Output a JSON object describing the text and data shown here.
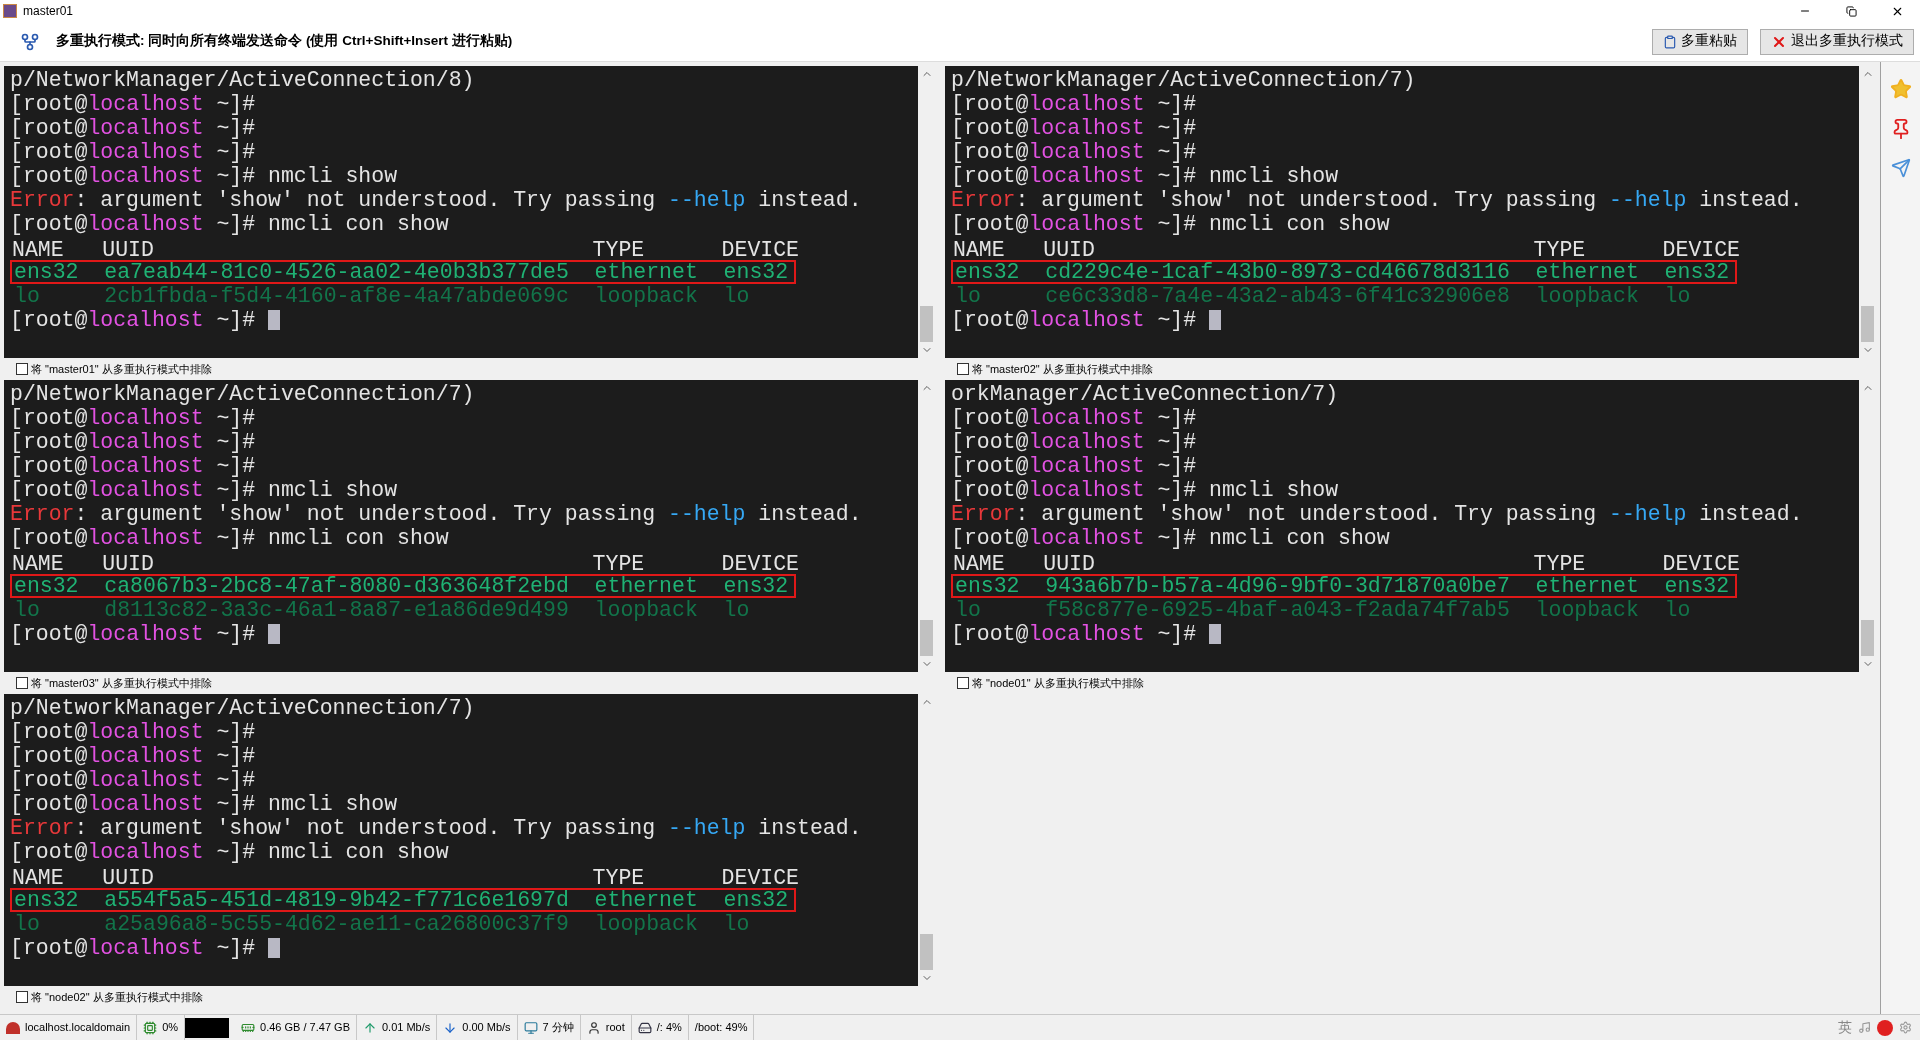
{
  "window": {
    "title": "master01"
  },
  "toolbar": {
    "message": "多重执行模式: 同时向所有终端发送命令 (使用 **Ctrl+Shift+Insert** 进行粘贴)",
    "buttons": [
      {
        "kind": "paste",
        "label": "多重粘贴"
      },
      {
        "kind": "exit",
        "label": "退出多重执行模式"
      }
    ]
  },
  "terminals": [
    {
      "exclude": {
        "label": "将 \"master01\" 从多重执行模式中排除",
        "checked": false
      },
      "lines": [
        {
          "kind": "text",
          "text": "p/NetworkManager/ActiveConnection/8)"
        },
        {
          "kind": "prompt",
          "user": "[root@",
          "host": "localhost",
          "suffix": " ~]#",
          "cursor": false
        },
        {
          "kind": "prompt",
          "user": "[root@",
          "host": "localhost",
          "suffix": " ~]#",
          "cursor": false
        },
        {
          "kind": "prompt",
          "user": "[root@",
          "host": "localhost",
          "suffix": " ~]#",
          "cursor": false
        },
        {
          "kind": "prompt",
          "user": "[root@",
          "host": "localhost",
          "suffix": " ~]#",
          "command": "nmcli show",
          "cursor": false
        },
        {
          "kind": "error",
          "label": "Error",
          "text": ": argument 'show' not understood. Try passing ",
          "flag": "--help",
          "rest": " instead."
        },
        {
          "kind": "prompt",
          "user": "[root@",
          "host": "localhost",
          "suffix": " ~]#",
          "command": "nmcli con show",
          "cursor": false
        },
        {
          "kind": "header",
          "cells": [
            "NAME",
            "UUID",
            "TYPE",
            "DEVICE"
          ]
        },
        {
          "kind": "row",
          "cells": [
            "ens32",
            "ea7eab44-81c0-4526-aa02-4e0b3b377de5",
            "ethernet",
            "ens32"
          ],
          "highlighted": true,
          "dim": false
        },
        {
          "kind": "row",
          "cells": [
            "lo",
            "2cb1fbda-f5d4-4160-af8e-4a47abde069c",
            "loopback",
            "lo"
          ],
          "highlighted": false,
          "dim": true
        },
        {
          "kind": "prompt",
          "user": "[root@",
          "host": "localhost",
          "suffix": " ~]#",
          "cursor": true
        }
      ]
    },
    {
      "exclude": {
        "label": "将 \"master02\" 从多重执行模式中排除",
        "checked": false
      },
      "lines": [
        {
          "kind": "text",
          "text": "p/NetworkManager/ActiveConnection/7)"
        },
        {
          "kind": "prompt",
          "user": "[root@",
          "host": "localhost",
          "suffix": " ~]#",
          "cursor": false
        },
        {
          "kind": "prompt",
          "user": "[root@",
          "host": "localhost",
          "suffix": " ~]#",
          "cursor": false
        },
        {
          "kind": "prompt",
          "user": "[root@",
          "host": "localhost",
          "suffix": " ~]#",
          "cursor": false
        },
        {
          "kind": "prompt",
          "user": "[root@",
          "host": "localhost",
          "suffix": " ~]#",
          "command": "nmcli show",
          "cursor": false
        },
        {
          "kind": "error",
          "label": "Error",
          "text": ": argument 'show' not understood. Try passing ",
          "flag": "--help",
          "rest": " instead."
        },
        {
          "kind": "prompt",
          "user": "[root@",
          "host": "localhost",
          "suffix": " ~]#",
          "command": "nmcli con show",
          "cursor": false
        },
        {
          "kind": "header",
          "cells": [
            "NAME",
            "UUID",
            "TYPE",
            "DEVICE"
          ]
        },
        {
          "kind": "row",
          "cells": [
            "ens32",
            "cd229c4e-1caf-43b0-8973-cd46678d3116",
            "ethernet",
            "ens32"
          ],
          "highlighted": true,
          "dim": false
        },
        {
          "kind": "row",
          "cells": [
            "lo",
            "ce6c33d8-7a4e-43a2-ab43-6f41c32906e8",
            "loopback",
            "lo"
          ],
          "highlighted": false,
          "dim": true
        },
        {
          "kind": "prompt",
          "user": "[root@",
          "host": "localhost",
          "suffix": " ~]#",
          "cursor": true
        }
      ]
    },
    {
      "exclude": {
        "label": "将 \"master03\" 从多重执行模式中排除",
        "checked": false
      },
      "lines": [
        {
          "kind": "text",
          "text": "p/NetworkManager/ActiveConnection/7)"
        },
        {
          "kind": "prompt",
          "user": "[root@",
          "host": "localhost",
          "suffix": " ~]#",
          "cursor": false
        },
        {
          "kind": "prompt",
          "user": "[root@",
          "host": "localhost",
          "suffix": " ~]#",
          "cursor": false
        },
        {
          "kind": "prompt",
          "user": "[root@",
          "host": "localhost",
          "suffix": " ~]#",
          "cursor": false
        },
        {
          "kind": "prompt",
          "user": "[root@",
          "host": "localhost",
          "suffix": " ~]#",
          "command": "nmcli show",
          "cursor": false
        },
        {
          "kind": "error",
          "label": "Error",
          "text": ": argument 'show' not understood. Try passing ",
          "flag": "--help",
          "rest": " instead."
        },
        {
          "kind": "prompt",
          "user": "[root@",
          "host": "localhost",
          "suffix": " ~]#",
          "command": "nmcli con show",
          "cursor": false
        },
        {
          "kind": "header",
          "cells": [
            "NAME",
            "UUID",
            "TYPE",
            "DEVICE"
          ]
        },
        {
          "kind": "row",
          "cells": [
            "ens32",
            "ca8067b3-2bc8-47af-8080-d363648f2ebd",
            "ethernet",
            "ens32"
          ],
          "highlighted": true,
          "dim": false
        },
        {
          "kind": "row",
          "cells": [
            "lo",
            "d8113c82-3a3c-46a1-8a87-e1a86de9d499",
            "loopback",
            "lo"
          ],
          "highlighted": false,
          "dim": true
        },
        {
          "kind": "prompt",
          "user": "[root@",
          "host": "localhost",
          "suffix": " ~]#",
          "cursor": true
        }
      ]
    },
    {
      "exclude": {
        "label": "将 \"node01\" 从多重执行模式中排除",
        "checked": false
      },
      "lines": [
        {
          "kind": "text",
          "text": "orkManager/ActiveConnection/7)"
        },
        {
          "kind": "prompt",
          "user": "[root@",
          "host": "localhost",
          "suffix": " ~]#",
          "cursor": false
        },
        {
          "kind": "prompt",
          "user": "[root@",
          "host": "localhost",
          "suffix": " ~]#",
          "cursor": false
        },
        {
          "kind": "prompt",
          "user": "[root@",
          "host": "localhost",
          "suffix": " ~]#",
          "cursor": false
        },
        {
          "kind": "prompt",
          "user": "[root@",
          "host": "localhost",
          "suffix": " ~]#",
          "command": "nmcli show",
          "cursor": false
        },
        {
          "kind": "error",
          "label": "Error",
          "text": ": argument 'show' not understood. Try passing ",
          "flag": "--help",
          "rest": " instead."
        },
        {
          "kind": "prompt",
          "user": "[root@",
          "host": "localhost",
          "suffix": " ~]#",
          "command": "nmcli con show",
          "cursor": false
        },
        {
          "kind": "header",
          "cells": [
            "NAME",
            "UUID",
            "TYPE",
            "DEVICE"
          ]
        },
        {
          "kind": "row",
          "cells": [
            "ens32",
            "943a6b7b-b57a-4d96-9bf0-3d71870a0be7",
            "ethernet",
            "ens32"
          ],
          "highlighted": true,
          "dim": false
        },
        {
          "kind": "row",
          "cells": [
            "lo",
            "f58c877e-6925-4baf-a043-f2ada74f7ab5",
            "loopback",
            "lo"
          ],
          "highlighted": false,
          "dim": true
        },
        {
          "kind": "prompt",
          "user": "[root@",
          "host": "localhost",
          "suffix": " ~]#",
          "cursor": true
        }
      ]
    },
    {
      "exclude": {
        "label": "将 \"node02\" 从多重执行模式中排除",
        "checked": false
      },
      "lines": [
        {
          "kind": "text",
          "text": "p/NetworkManager/ActiveConnection/7)"
        },
        {
          "kind": "prompt",
          "user": "[root@",
          "host": "localhost",
          "suffix": " ~]#",
          "cursor": false
        },
        {
          "kind": "prompt",
          "user": "[root@",
          "host": "localhost",
          "suffix": " ~]#",
          "cursor": false
        },
        {
          "kind": "prompt",
          "user": "[root@",
          "host": "localhost",
          "suffix": " ~]#",
          "cursor": false
        },
        {
          "kind": "prompt",
          "user": "[root@",
          "host": "localhost",
          "suffix": " ~]#",
          "command": "nmcli show",
          "cursor": false
        },
        {
          "kind": "error",
          "label": "Error",
          "text": ": argument 'show' not understood. Try passing ",
          "flag": "--help",
          "rest": " instead."
        },
        {
          "kind": "prompt",
          "user": "[root@",
          "host": "localhost",
          "suffix": " ~]#",
          "command": "nmcli con show",
          "cursor": false
        },
        {
          "kind": "header",
          "cells": [
            "NAME",
            "UUID",
            "TYPE",
            "DEVICE"
          ]
        },
        {
          "kind": "row",
          "cells": [
            "ens32",
            "a554f5a5-451d-4819-9b42-f771c6e1697d",
            "ethernet",
            "ens32"
          ],
          "highlighted": true,
          "dim": false
        },
        {
          "kind": "row",
          "cells": [
            "lo",
            "a25a96a8-5c55-4d62-ae11-ca26800c37f9",
            "loopback",
            "lo"
          ],
          "highlighted": false,
          "dim": true
        },
        {
          "kind": "prompt",
          "user": "[root@",
          "host": "localhost",
          "suffix": " ~]#",
          "cursor": true
        }
      ]
    }
  ],
  "status_bar": {
    "items": [
      {
        "kind": "host",
        "text": "localhost.localdomain"
      },
      {
        "kind": "cpu",
        "text": "0%"
      },
      {
        "kind": "graph"
      },
      {
        "kind": "memory",
        "text": "0.46 GB / 7.47 GB"
      },
      {
        "kind": "upload",
        "text": "0.01 Mb/s"
      },
      {
        "kind": "download",
        "text": "0.00 Mb/s"
      },
      {
        "kind": "uptime",
        "text": "7 分钟"
      },
      {
        "kind": "user",
        "text": "root"
      },
      {
        "kind": "disk",
        "text": "/: 4%"
      },
      {
        "kind": "plain",
        "text": "/boot: 49%"
      }
    ],
    "ime_label": "英"
  }
}
